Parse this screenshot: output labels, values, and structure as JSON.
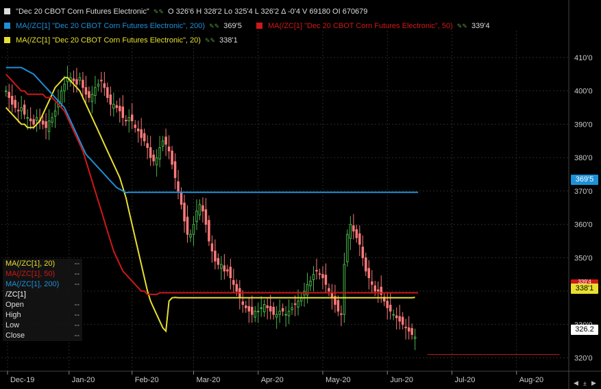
{
  "header": {
    "main_symbol": "\"Dec 20 CBOT Corn Futures Electronic\"",
    "ohlc_text": "O 326'6  H 328'2  Lo 325'4  L 326'2  Δ -0'4  V 69180  OI 670679",
    "ma200_label": "MA(/ZC[1] \"Dec 20 CBOT Corn Futures Electronic\", 200)",
    "ma200_value": "369'5",
    "ma50_label": "MA(/ZC[1] \"Dec 20 CBOT Corn Futures Electronic\", 50)",
    "ma50_value": "339'4",
    "ma20_label": "MA(/ZC[1] \"Dec 20 CBOT Corn Futures Electronic\", 20)",
    "ma20_value": "338'1"
  },
  "colors": {
    "ma200": "#1e90d8",
    "ma50": "#d01818",
    "ma20": "#e8e030",
    "up": "#4ab84a",
    "down": "#ff7a7a",
    "bg": "#000000",
    "grid": "#2a2a2a"
  },
  "data_box": {
    "rows": [
      {
        "label": "MA(/ZC[1], 20)",
        "value": "--",
        "color": "#e8e030"
      },
      {
        "label": "MA(/ZC[1], 50)",
        "value": "--",
        "color": "#d01818"
      },
      {
        "label": "MA(/ZC[1], 200)",
        "value": "--",
        "color": "#1e90d8"
      },
      {
        "label": "/ZC[1]",
        "value": "",
        "color": "#ffffff"
      },
      {
        "label": "Open",
        "value": "--",
        "color": "#dddddd"
      },
      {
        "label": "High",
        "value": "--",
        "color": "#dddddd"
      },
      {
        "label": "Low",
        "value": "--",
        "color": "#dddddd"
      },
      {
        "label": "Close",
        "value": "--",
        "color": "#dddddd"
      }
    ]
  },
  "price_tags": {
    "ma200": "369'5",
    "ma50": "339'4",
    "ma20": "338'1",
    "last": "326.2"
  },
  "chart_data": {
    "type": "candlestick",
    "y_ticks": [
      "320'0",
      "330'0",
      "340'0",
      "350'0",
      "360'0",
      "370'0",
      "380'0",
      "390'0",
      "400'0",
      "410'0"
    ],
    "y_tick_values": [
      320,
      330,
      340,
      350,
      360,
      370,
      380,
      390,
      400,
      410
    ],
    "ylim": [
      316,
      418
    ],
    "x_labels": [
      "Dec-19",
      "Jan-20",
      "Feb-20",
      "Mar-20",
      "Apr-20",
      "May-20",
      "Jun-20",
      "Jul-20",
      "Aug-20"
    ],
    "x_label_positions": [
      0.5,
      20.5,
      41,
      61,
      82,
      103,
      124,
      145,
      166
    ],
    "xlim": [
      -1.5,
      183
    ],
    "grid": true,
    "low_line": {
      "value": 321,
      "from_index": 137,
      "to_index": 180
    },
    "close": [
      400,
      398,
      396,
      395,
      394,
      395,
      393,
      392,
      391,
      390,
      392,
      391,
      390,
      389,
      391,
      392,
      394,
      397,
      400,
      402,
      404,
      404,
      403,
      402,
      404,
      401,
      399,
      398,
      399,
      401,
      402,
      403,
      401,
      398,
      396,
      396,
      395,
      394,
      392,
      391,
      392,
      391,
      389,
      388,
      386,
      385,
      383,
      380,
      379,
      380,
      383,
      385,
      384,
      382,
      378,
      374,
      370,
      366,
      361,
      357,
      357,
      360,
      364,
      366,
      364,
      360,
      355,
      352,
      349,
      348,
      348,
      346,
      346,
      344,
      342,
      340,
      338,
      336,
      335,
      334,
      333,
      334,
      334,
      335,
      336,
      335,
      334,
      333,
      333,
      334,
      334,
      333,
      334,
      335,
      336,
      337,
      338,
      340,
      342,
      343,
      345,
      346,
      345,
      344,
      342,
      340,
      338,
      336,
      334,
      333,
      348,
      357,
      360,
      358,
      356,
      354,
      350,
      346,
      344,
      342,
      340,
      340,
      339,
      337,
      335,
      334,
      333,
      332,
      331,
      330,
      329,
      328,
      327,
      326.25
    ],
    "series": [
      {
        "name": "MA(/ZC[1] \"Dec 20 CBOT Corn Futures Electronic\", 20)",
        "values": [
          395,
          394,
          393,
          392,
          391,
          390,
          390,
          389,
          389,
          389,
          390,
          391,
          393,
          395,
          397,
          399,
          401,
          402,
          403,
          404,
          404,
          403,
          402,
          401,
          400,
          398,
          396,
          394,
          392,
          390,
          388,
          386,
          384,
          382,
          380,
          378,
          376,
          374,
          371,
          368,
          364,
          360,
          356,
          352,
          348,
          344,
          340,
          337,
          335,
          333,
          331,
          329,
          328,
          337,
          338,
          338.1,
          338,
          338,
          338,
          338,
          338,
          338,
          338,
          338,
          338,
          338,
          338,
          338,
          338,
          338,
          338,
          338,
          338,
          338,
          338,
          338,
          338,
          338,
          338,
          338,
          338,
          338,
          338,
          338,
          338,
          338,
          338,
          338,
          338,
          338,
          338,
          338,
          338,
          338,
          338,
          338,
          338,
          338,
          338,
          338,
          338,
          338,
          338,
          338,
          338,
          338,
          338,
          338,
          338,
          338,
          338,
          338,
          338,
          338,
          338,
          338,
          338,
          338,
          338,
          338,
          338,
          338,
          338,
          338,
          338,
          338,
          338,
          338,
          338,
          338,
          338,
          338,
          338,
          338.1
        ]
      },
      {
        "name": "MA(/ZC[1] \"Dec 20 CBOT Corn Futures Electronic\", 50)",
        "values": [
          405,
          404,
          403,
          402,
          401,
          400,
          400,
          399,
          399,
          399,
          399,
          399,
          399,
          398,
          398,
          398,
          397,
          396,
          395,
          394,
          392,
          390,
          388,
          386,
          384,
          382,
          379,
          376,
          373,
          370,
          367,
          364,
          361,
          358,
          355,
          352,
          350,
          348,
          346,
          345,
          344,
          343,
          342,
          341,
          340,
          340,
          339,
          339,
          339,
          339,
          339.5,
          339.5,
          339.5,
          339.5,
          339.5,
          339.5,
          339.5,
          339.5,
          339.5,
          339.5,
          339.5,
          339.5,
          339.5,
          339.5,
          339.5,
          339.5,
          339.5,
          339.5,
          339.5,
          339.5,
          339.5,
          339.5,
          339.5,
          339.5,
          339.5,
          339.5,
          339.5,
          339.5,
          339.5,
          339.5,
          339.5,
          339.5,
          339.5,
          339.5,
          339.5,
          339.5,
          339.5,
          339.5,
          339.5,
          339.5,
          339.5,
          339.5,
          339.5,
          339.5,
          339.5,
          339.5,
          339.5,
          339.5,
          339.5,
          339.5,
          339.5,
          339.5,
          339.5,
          339.5,
          339.5,
          339.5,
          339.5,
          339.5,
          339.5,
          339.5,
          339.5,
          339.5,
          339.5,
          339.5,
          339.5,
          339.5,
          339.5,
          339.5,
          339.5,
          339.5,
          339.5,
          339.5,
          339.5,
          339.5,
          339.5,
          339.5,
          339.5,
          339.5,
          339.5,
          339.5,
          339.5,
          339.5,
          339.5,
          339.5,
          339.5
        ]
      },
      {
        "name": "MA(/ZC[1] \"Dec 20 CBOT Corn Futures Electronic\", 200)",
        "values": [
          407,
          407,
          407,
          407,
          407,
          407,
          406.5,
          406,
          405.5,
          405,
          404,
          403,
          402,
          401,
          400,
          399,
          398,
          397,
          396,
          395,
          393,
          391,
          389,
          387,
          385,
          383,
          381,
          380,
          379,
          378,
          377,
          376,
          375,
          374,
          373,
          372,
          371,
          370.5,
          370,
          369.5,
          369.6,
          369.6,
          369.6,
          369.6,
          369.6,
          369.6,
          369.6,
          369.6,
          369.6,
          369.6,
          369.6,
          369.6,
          369.6,
          369.6,
          369.6,
          369.6,
          369.6,
          369.6,
          369.6,
          369.6,
          369.6,
          369.6,
          369.6,
          369.6,
          369.6,
          369.6,
          369.6,
          369.6,
          369.6,
          369.6,
          369.6,
          369.6,
          369.6,
          369.6,
          369.6,
          369.6,
          369.6,
          369.6,
          369.6,
          369.6,
          369.6,
          369.6,
          369.6,
          369.6,
          369.6,
          369.6,
          369.6,
          369.6,
          369.6,
          369.6,
          369.6,
          369.6,
          369.6,
          369.6,
          369.6,
          369.6,
          369.6,
          369.6,
          369.6,
          369.6,
          369.6,
          369.6,
          369.6,
          369.6,
          369.6,
          369.6,
          369.6,
          369.6,
          369.6,
          369.6,
          369.6,
          369.6,
          369.6,
          369.6,
          369.6,
          369.6,
          369.6,
          369.6,
          369.6,
          369.6,
          369.6,
          369.6,
          369.6,
          369.6,
          369.6,
          369.6,
          369.6,
          369.6,
          369.6,
          369.6,
          369.6,
          369.6,
          369.6,
          369.6,
          369.6
        ]
      }
    ]
  }
}
